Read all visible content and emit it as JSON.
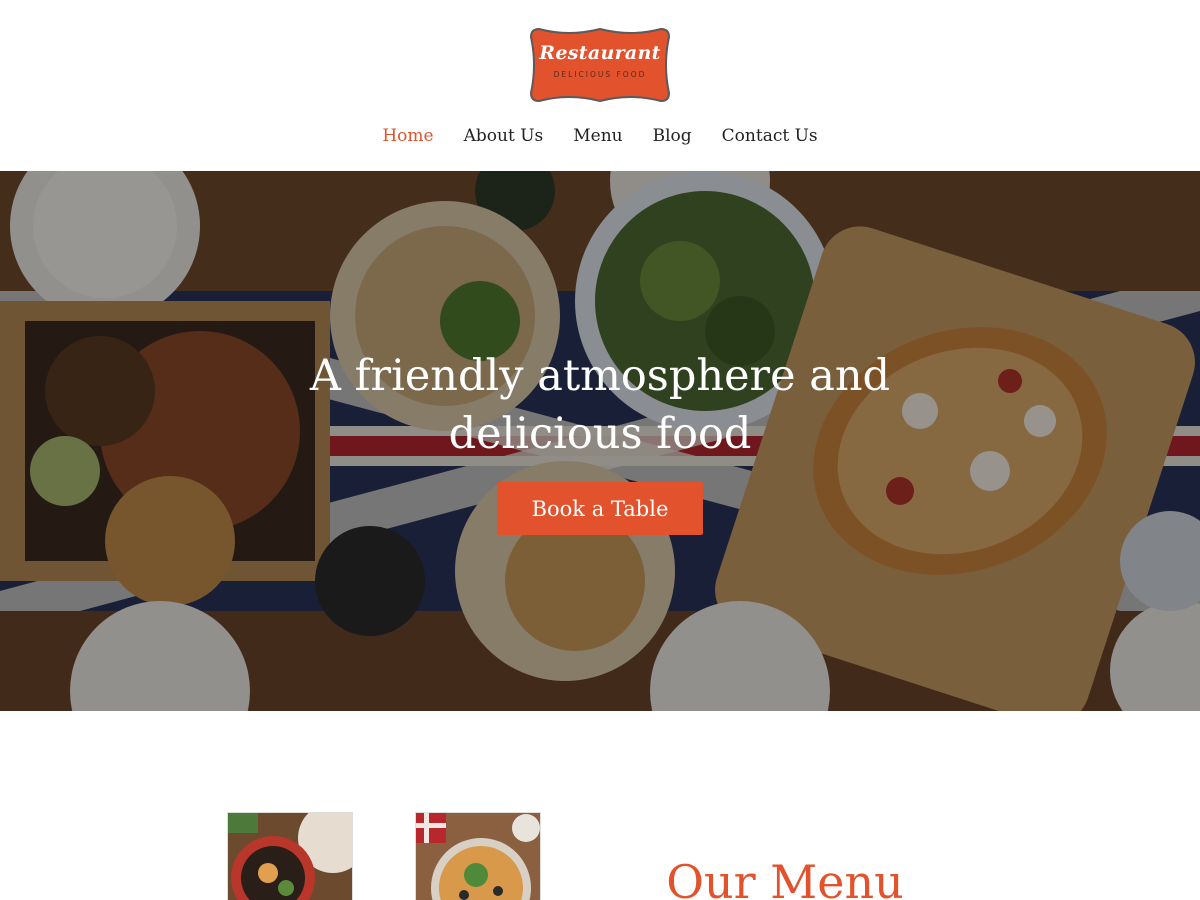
{
  "brand": {
    "name": "Restaurant",
    "tagline": "DELICIOUS FOOD",
    "accent_color": "#e2522d"
  },
  "nav": {
    "items": [
      {
        "label": "Home",
        "active": true
      },
      {
        "label": "About Us",
        "active": false
      },
      {
        "label": "Menu",
        "active": false
      },
      {
        "label": "Blog",
        "active": false
      },
      {
        "label": "Contact Us",
        "active": false
      }
    ]
  },
  "hero": {
    "title_line1": "A friendly atmosphere and",
    "title_line2": "delicious food",
    "button_label": "Book a Table"
  },
  "menu_section": {
    "heading": "Our Menu",
    "thumbnails": [
      "bowl-dish-photo",
      "pizza-photo"
    ]
  }
}
